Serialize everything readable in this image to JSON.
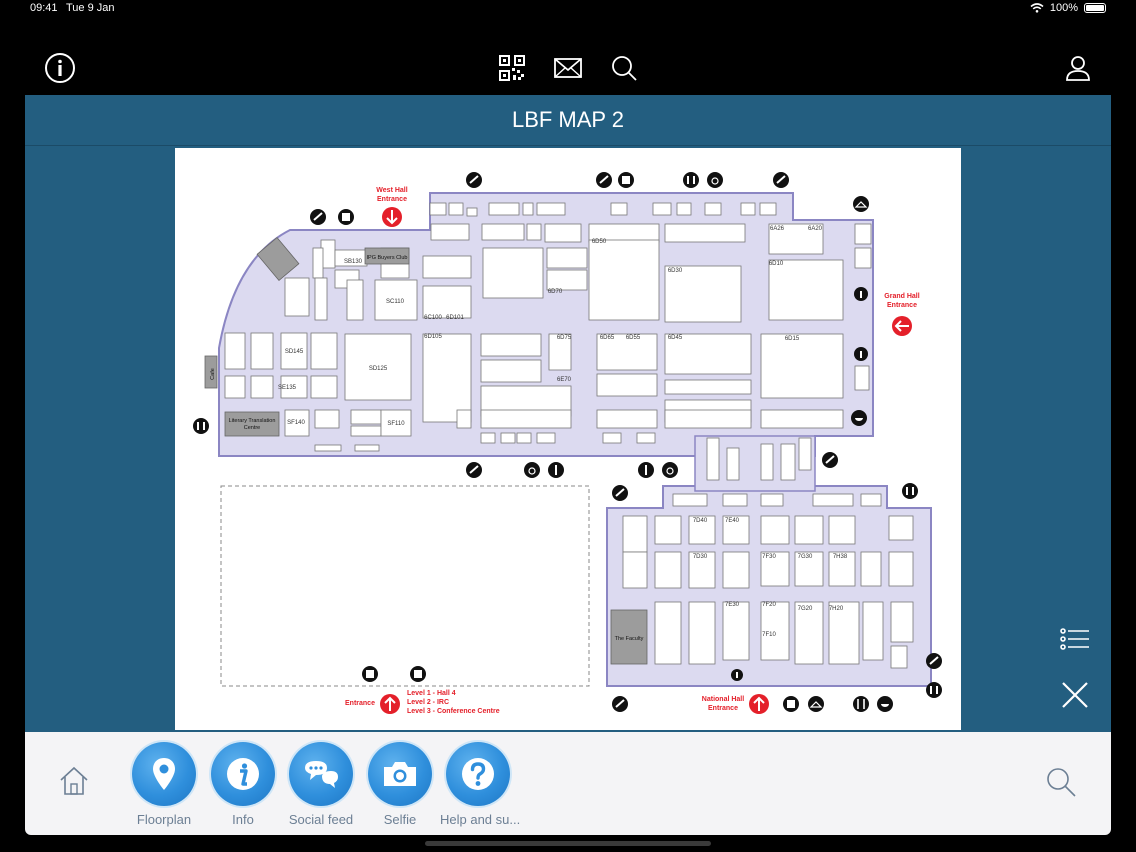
{
  "status": {
    "time": "09:41",
    "date": "Tue 9 Jan",
    "battery": "100%"
  },
  "topbar": {
    "icons": [
      "info-icon",
      "qr-code-icon",
      "mail-icon",
      "search-icon",
      "user-icon"
    ]
  },
  "panel": {
    "title": "LBF MAP 2"
  },
  "map": {
    "labels": {
      "west_entrance_1": "West Hall",
      "west_entrance_2": "Entrance",
      "grand_entrance_1": "Grand Hall",
      "grand_entrance_2": "Entrance",
      "national_entrance_1": "National Hall",
      "national_entrance_2": "Entrance",
      "entrance": "Entrance",
      "level1": "Level 1 - Hall 4",
      "level2": "Level 2 - IRC",
      "level3": "Level 3 - Conference Centre",
      "cafe": "Cafe",
      "ltc_1": "Literary Translation",
      "ltc_2": "Centre",
      "faculty": "The Faculty",
      "ipg": "IPG Buyers Club"
    },
    "stands": [
      "SB130",
      "SC110",
      "SD125",
      "SD145",
      "SE135",
      "SF140",
      "SF110",
      "6D50",
      "6D30",
      "6D10",
      "6A20",
      "6A26",
      "6D15",
      "6D45",
      "6D55",
      "6D65",
      "6D75",
      "6E70",
      "6D70",
      "6D105",
      "6C100",
      "6D101",
      "7D40",
      "7E40",
      "7F30",
      "7F20",
      "7F10",
      "7G30",
      "7G20",
      "7H20",
      "7H38",
      "7E30",
      "7D30"
    ]
  },
  "side": {
    "list_icon": "list-icon",
    "close_icon": "close-icon"
  },
  "bottom_nav": {
    "items": [
      {
        "label": "Floorplan",
        "icon": "map-pin-icon"
      },
      {
        "label": "Info",
        "icon": "info-icon"
      },
      {
        "label": "Social feed",
        "icon": "chat-bubbles-icon"
      },
      {
        "label": "Selfie",
        "icon": "camera-icon"
      },
      {
        "label": "Help and su...",
        "icon": "question-icon"
      }
    ]
  },
  "colors": {
    "panel": "#235e80",
    "hall": "#dcdaf0",
    "hall_border": "#8b86c3",
    "accent_red": "#e4202a",
    "nav_blue": "#2f8fdc"
  }
}
